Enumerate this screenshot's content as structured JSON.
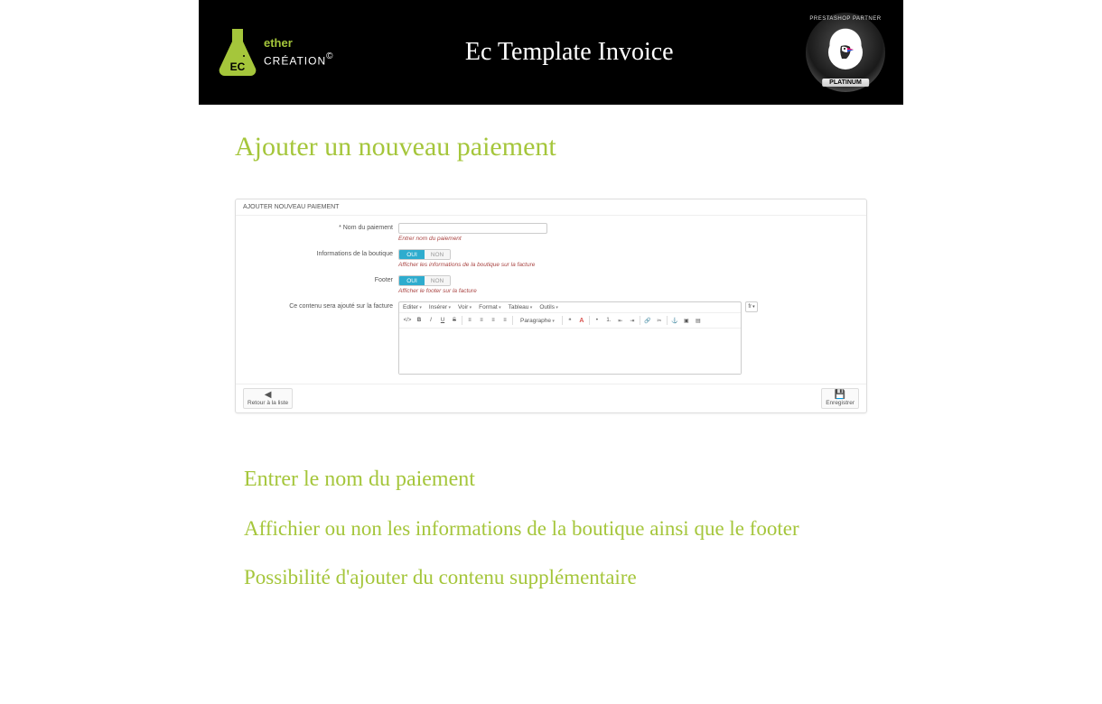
{
  "header": {
    "brand_top": "ether",
    "brand_bottom": "CRÉATION",
    "brand_mark": "EC",
    "copyright": "©",
    "title": "Ec Template Invoice",
    "partner_arc": "PRESTASHOP PARTNER",
    "partner_ribbon": "PLATINUM"
  },
  "page": {
    "heading": "Ajouter un nouveau paiement"
  },
  "panel": {
    "title": "AJOUTER NOUVEAU PAIEMENT",
    "fields": {
      "name": {
        "label": "* Nom du paiement",
        "value": "",
        "help": "Entrer nom du paiement"
      },
      "shop_info": {
        "label": "Informations de la boutique",
        "on": "OUI",
        "off": "NON",
        "value": true,
        "help": "Afficher les informations de la boutique sur la facture"
      },
      "footer": {
        "label": "Footer",
        "on": "OUI",
        "off": "NON",
        "value": true,
        "help": "Afficher le footer sur la facture"
      },
      "content": {
        "label": "Ce contenu sera ajouté sur la facture",
        "menus": [
          "Editer",
          "Insérer",
          "Voir",
          "Format",
          "Tableau",
          "Outils"
        ],
        "paragraph": "Paragraphe",
        "lang": "fr"
      }
    },
    "footer_buttons": {
      "back": "Retour à la liste",
      "save": "Enregistrer"
    }
  },
  "callouts": {
    "c1": "Entrer le nom du paiement",
    "c2": "Affichier ou non les informations de la boutique ainsi que le footer",
    "c3": "Possibilité d'ajouter du contenu supplémentaire"
  }
}
